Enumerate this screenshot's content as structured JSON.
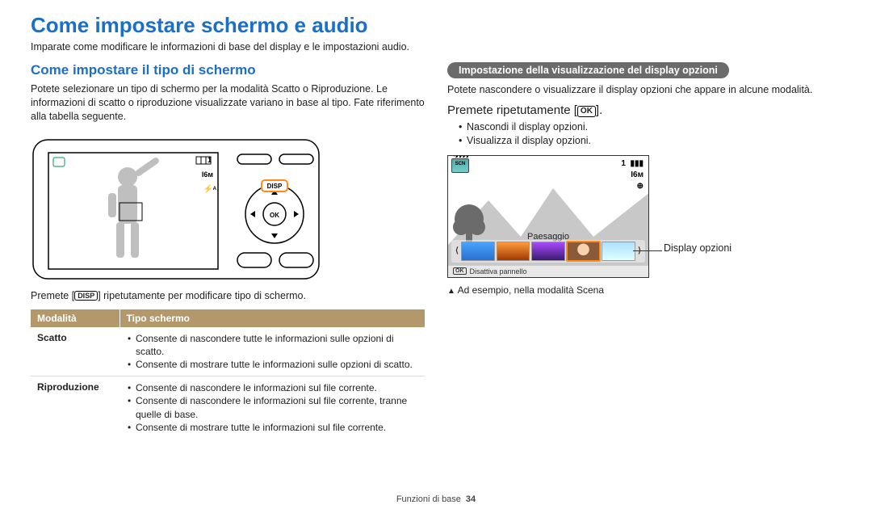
{
  "title": "Come impostare schermo e audio",
  "intro": "Imparate come modificare le informazioni di base del display e le impostazioni audio.",
  "left": {
    "heading": "Come impostare il tipo di schermo",
    "para": "Potete selezionare un tipo di schermo per la modalità Scatto o Riproduzione. Le informazioni di scatto o riproduzione visualizzate variano in base al tipo. Fate riferimento alla tabella seguente.",
    "caption_pre": "Premete [",
    "caption_chip": "DISP",
    "caption_post": "] ripetutamente per modificare tipo di schermo.",
    "table": {
      "head": {
        "col1": "Modalità",
        "col2": "Tipo schermo"
      },
      "rows": [
        {
          "mode": "Scatto",
          "items": [
            "Consente di nascondere tutte le informazioni sulle opzioni di scatto.",
            "Consente di mostrare tutte le informazioni sulle opzioni di scatto."
          ]
        },
        {
          "mode": "Riproduzione",
          "items": [
            "Consente di nascondere le informazioni sul file corrente.",
            "Consente di nascondere le informazioni sul file corrente, tranne quelle di base.",
            "Consente di mostrare tutte le informazioni sul file corrente."
          ]
        }
      ]
    },
    "osd": {
      "count": "1",
      "res": "I6ᴍ",
      "flash": "⚡ᴬ"
    }
  },
  "right": {
    "pill": "Impostazione della visualizzazione del display opzioni",
    "para": "Potete nascondere o visualizzare il display opzioni che appare in alcune modalità.",
    "action_pre": "Premete ripetutamente [",
    "action_chip": "OK",
    "action_post": "].",
    "bullets": [
      "Nascondi il display opzioni.",
      "Visualizza il display opzioni."
    ],
    "preview": {
      "scn": "SCN",
      "scene_label": "Paesaggio",
      "osd": {
        "count": "1",
        "res": "I6ᴍ",
        "nav": "⊕"
      },
      "footer_ok": "OK",
      "footer_text": "Disattiva pannello"
    },
    "callout": "Display opzioni",
    "example_caption": "Ad esempio, nella modalità Scena"
  },
  "footer": {
    "section": "Funzioni di base",
    "page": "34"
  }
}
